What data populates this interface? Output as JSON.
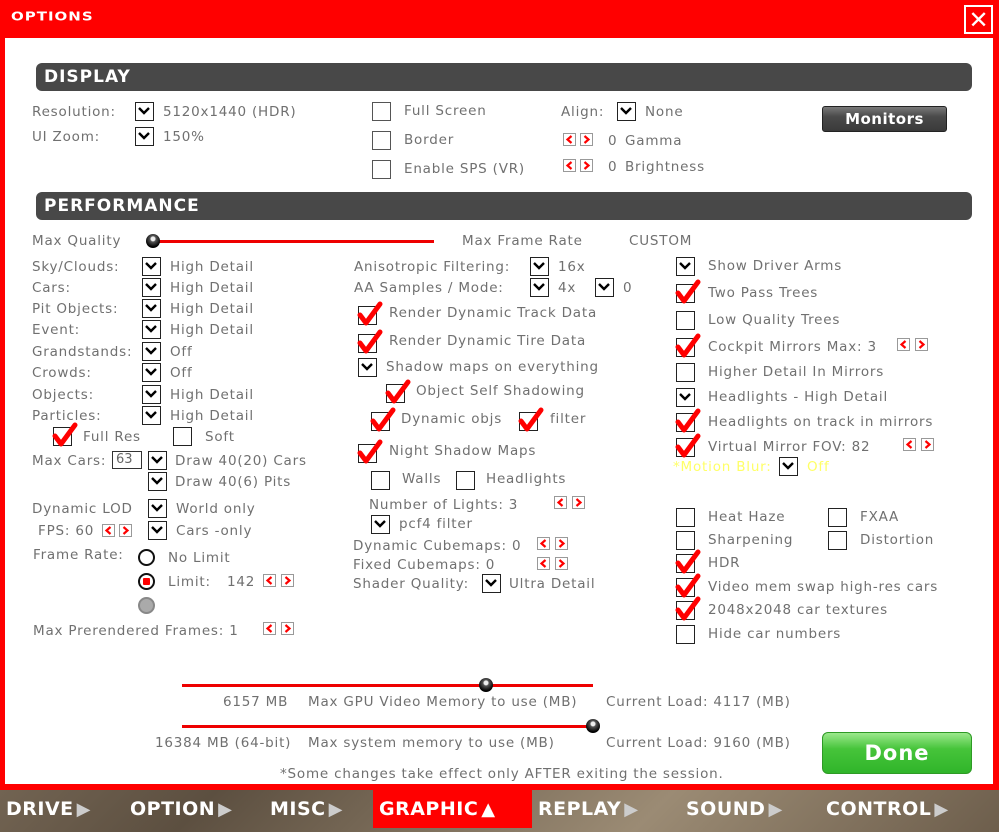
{
  "window": {
    "title": "OPTIONS",
    "close_icon": "close-icon"
  },
  "display": {
    "header": "DISPLAY",
    "resolution_label": "Resolution:",
    "resolution_value": "5120x1440 (HDR)",
    "ui_zoom_label": "UI Zoom:",
    "ui_zoom_value": "150%",
    "full_screen": {
      "label": "Full Screen",
      "checked": false
    },
    "border": {
      "label": "Border",
      "checked": false
    },
    "enable_sps": {
      "label": "Enable SPS (VR)",
      "checked": false
    },
    "align_label": "Align:",
    "align_value": "None",
    "gamma": {
      "value": "0",
      "label": "Gamma"
    },
    "brightness": {
      "value": "0",
      "label": "Brightness"
    },
    "monitors_button": "Monitors"
  },
  "performance": {
    "header": "PERFORMANCE",
    "quality_slider": {
      "left_label": "Max Quality",
      "right_label": "Max Frame Rate",
      "preset": "CUSTOM",
      "position": 0.0
    },
    "detail_rows": [
      {
        "label": "Sky/Clouds:",
        "value": "High Detail"
      },
      {
        "label": "Cars:",
        "value": "High Detail"
      },
      {
        "label": "Pit Objects:",
        "value": "High Detail"
      },
      {
        "label": "Event:",
        "value": "High Detail"
      },
      {
        "label": "Grandstands:",
        "value": "Off"
      },
      {
        "label": "Crowds:",
        "value": "Off"
      },
      {
        "label": "Objects:",
        "value": "High Detail"
      },
      {
        "label": "Particles:",
        "value": "High Detail"
      }
    ],
    "full_res": {
      "label": "Full Res",
      "checked": true
    },
    "soft": {
      "label": "Soft",
      "checked": false
    },
    "max_cars_label": "Max Cars:",
    "max_cars_value": "63",
    "draw_cars": "Draw 40(20) Cars",
    "draw_pits": "Draw 40(6) Pits",
    "dynamic_lod_label": "Dynamic LOD",
    "dynamic_lod_world": "World  only",
    "fps_label": "FPS: 60",
    "dynamic_lod_cars": "Cars -only",
    "frame_rate_label": "Frame Rate:",
    "frame_rate_options": [
      {
        "label": "No Limit",
        "selected": false
      },
      {
        "label": "Limit:",
        "value": "142",
        "selected": true
      }
    ],
    "max_prerendered_frames": "Max Prerendered Frames: 1",
    "anisotropic_label": "Anisotropic Filtering:",
    "anisotropic_value": "16x",
    "aa_label": "AA Samples / Mode:",
    "aa_samples": "4x",
    "aa_mode": "0",
    "render_track_data": {
      "label": "Render Dynamic Track Data",
      "checked": true
    },
    "render_tire_data": {
      "label": "Render Dynamic Tire Data",
      "checked": true
    },
    "shadow_maps_everything": {
      "label": "Shadow maps on everything"
    },
    "object_self_shadowing": {
      "label": "Object Self Shadowing",
      "checked": true
    },
    "dynamic_objs": {
      "label": "Dynamic objs",
      "checked": true
    },
    "filter": {
      "label": "filter",
      "checked": true
    },
    "night_shadow_maps": {
      "label": "Night Shadow Maps",
      "checked": true
    },
    "walls": {
      "label": "Walls",
      "checked": false
    },
    "headlights_shadow": {
      "label": "Headlights",
      "checked": false
    },
    "number_of_lights": "Number of Lights: 3",
    "pcf4_filter": "pcf4 filter",
    "dynamic_cubemaps": "Dynamic Cubemaps: 0",
    "fixed_cubemaps": "Fixed Cubemaps: 0",
    "shader_quality_label": "Shader Quality:",
    "shader_quality_value": "Ultra Detail",
    "right_options": [
      {
        "label": "Show Driver Arms",
        "state": "dropdown"
      },
      {
        "label": "Two Pass Trees",
        "state": "checked"
      },
      {
        "label": "Low Quality Trees",
        "state": "unchecked"
      },
      {
        "label": "Cockpit Mirrors  Max:  3",
        "state": "checked"
      },
      {
        "label": "Higher Detail In Mirrors",
        "state": "unchecked"
      },
      {
        "label": "Headlights - High Detail",
        "state": "dropdown"
      },
      {
        "label": "Headlights on track in mirrors",
        "state": "checked"
      },
      {
        "label": "Virtual Mirror  FOV:  82",
        "state": "checked"
      }
    ],
    "motion_blur_label": "*Motion Blur:",
    "motion_blur_value": "Off",
    "post_options": [
      {
        "label": "Heat Haze",
        "checked": false
      },
      {
        "label": "FXAA",
        "checked": false
      },
      {
        "label": "Sharpening",
        "checked": false
      },
      {
        "label": "Distortion",
        "checked": false
      },
      {
        "label": "HDR",
        "checked": true
      },
      {
        "label": "Video mem swap high-res cars",
        "checked": true
      },
      {
        "label": "2048x2048 car textures",
        "checked": true
      },
      {
        "label": "Hide car numbers",
        "checked": false
      }
    ]
  },
  "memory": {
    "gpu": {
      "value": "6157 MB",
      "label": "Max GPU Video Memory to use (MB)",
      "current_load": "Current Load: 4117 (MB)",
      "position": 0.74
    },
    "system": {
      "value": "16384 MB (64-bit)",
      "label": "Max system memory to use (MB)",
      "current_load": "Current Load: 9160 (MB)",
      "position": 1.0
    }
  },
  "footnote": "*Some changes take effect only AFTER exiting the session.",
  "done_button": "Done",
  "nav_tabs": [
    {
      "label": "DRIVE",
      "active": false
    },
    {
      "label": "OPTION",
      "active": false
    },
    {
      "label": "MISC",
      "active": false
    },
    {
      "label": "GRAPHIC",
      "active": true
    },
    {
      "label": "REPLAY",
      "active": false
    },
    {
      "label": "SOUND",
      "active": false
    },
    {
      "label": "CONTROL",
      "active": false
    }
  ],
  "colors": {
    "accent_red": "#ff0000",
    "done_green": "#46c43a",
    "section_gray": "#484848",
    "motion_blur_yellow": "#ffff66"
  }
}
